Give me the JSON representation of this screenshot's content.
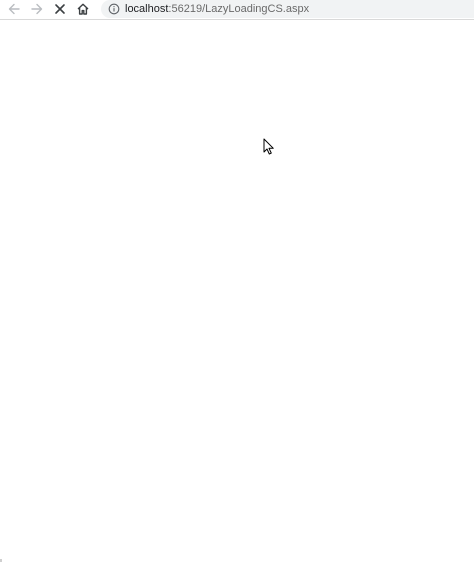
{
  "browser": {
    "address_bar": {
      "host": "localhost",
      "rest": ":56219/LazyLoadingCS.aspx"
    },
    "icons": {
      "back": "back-arrow-icon",
      "forward": "forward-arrow-icon",
      "stop": "stop-loading-icon",
      "home": "home-icon",
      "site_info": "info-icon",
      "pointer": "mouse-pointer-icon"
    },
    "colors": {
      "toolbar_bg": "#ffffff",
      "omnibox_bg": "#f1f3f4",
      "icon_gray": "#5f6368",
      "icon_disabled": "#b9bcc0",
      "page_bg": "#ffffff"
    }
  }
}
